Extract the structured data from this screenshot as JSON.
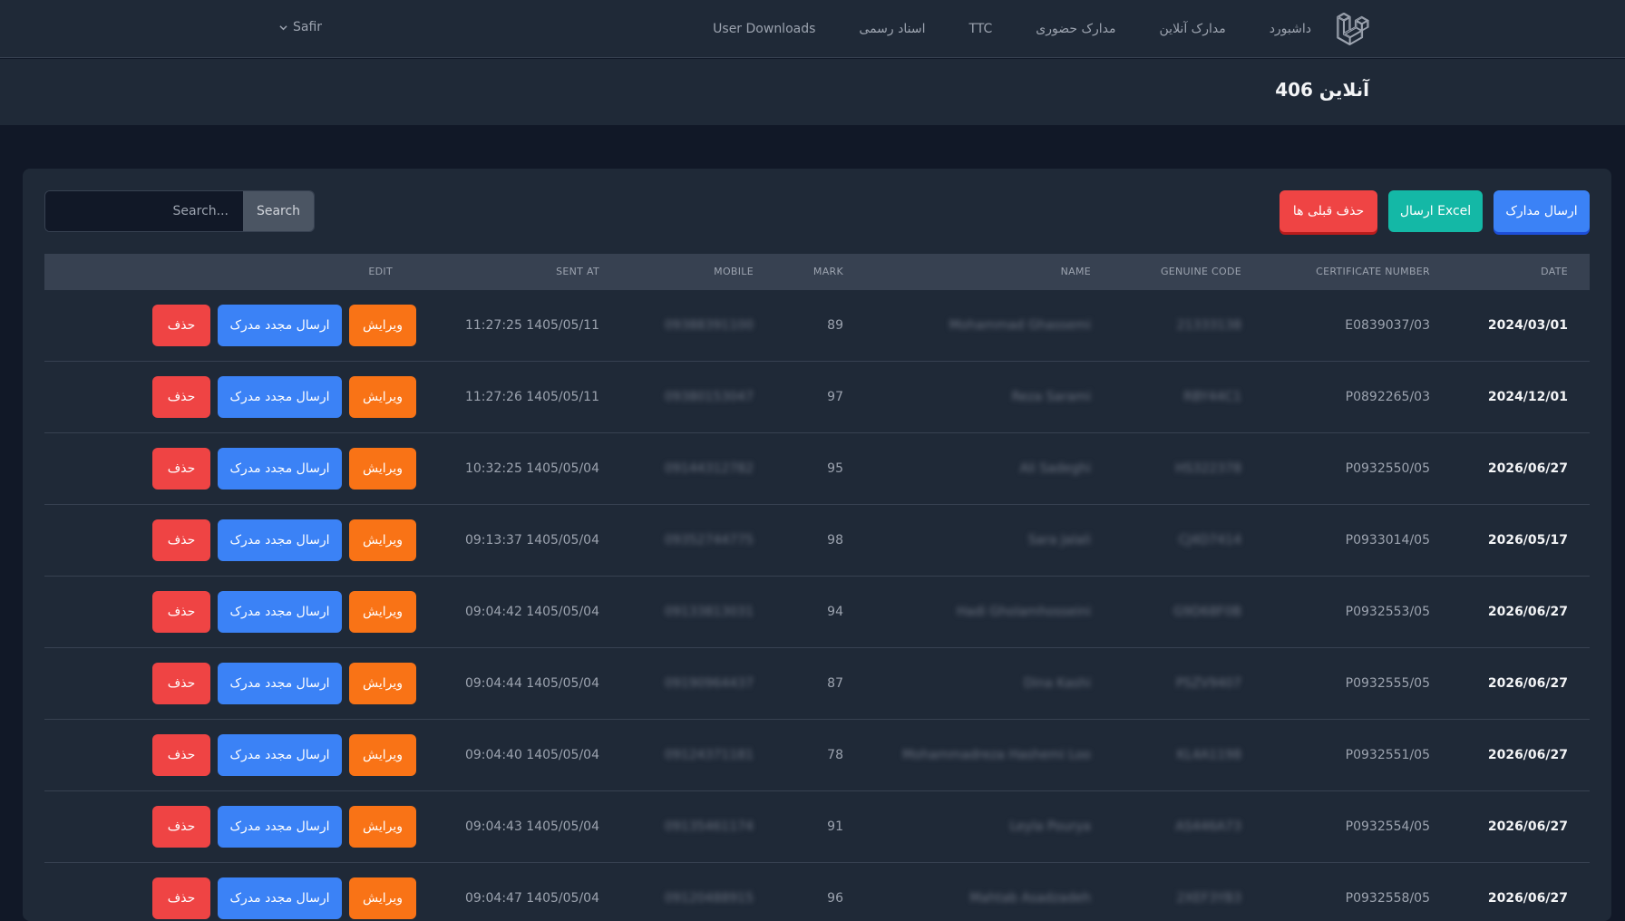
{
  "nav": {
    "links": [
      "داشبورد",
      "مدارک آنلاین",
      "مدارک حضوری",
      "TTC",
      "اسناد رسمی",
      "User Downloads"
    ],
    "user": "Safir"
  },
  "header": {
    "title": "آنلاین 406"
  },
  "toolbar": {
    "send_docs": "ارسال مدارک",
    "send_excel": "ارسال Excel",
    "delete_previous": "حذف قبلی ها",
    "search_placeholder": "Search...",
    "search_button": "Search"
  },
  "table": {
    "headers": {
      "date": "DATE",
      "certificate_number": "CERTIFICATE NUMBER",
      "genuine_code": "GENUINE CODE",
      "name": "NAME",
      "mark": "MARK",
      "mobile": "MOBILE",
      "sent_at": "SENT AT",
      "edit": "EDIT"
    },
    "row_buttons": {
      "edit": "ویرایش",
      "resend": "ارسال مجدد مدرک",
      "delete": "حذف"
    },
    "rows": [
      {
        "date": "2024/03/01",
        "cert": "E0839037/03",
        "code": "21333138",
        "name": "Mohammad Ghassemi",
        "mark": "89",
        "mobile": "09388391100",
        "sent_at": "11:27:25 1405/05/11"
      },
      {
        "date": "2024/12/01",
        "cert": "P0892265/03",
        "code": "RBY44C1",
        "name": "Reza Sarami",
        "mark": "97",
        "mobile": "09380153047",
        "sent_at": "11:27:26 1405/05/11"
      },
      {
        "date": "2026/06/27",
        "cert": "P0932550/05",
        "code": "HS322378",
        "name": "Ali Sadeghi",
        "mark": "95",
        "mobile": "09144312782",
        "sent_at": "10:32:25 1405/05/04"
      },
      {
        "date": "2026/05/17",
        "cert": "P0933014/05",
        "code": "CJ4D7414",
        "name": "Sara Jalali",
        "mark": "98",
        "mobile": "09352744775",
        "sent_at": "09:13:37 1405/05/04"
      },
      {
        "date": "2026/06/27",
        "cert": "P0932553/05",
        "code": "G9D68F0B",
        "name": "Hadi Gholamhosseini",
        "mark": "94",
        "mobile": "09133813031",
        "sent_at": "09:04:42 1405/05/04"
      },
      {
        "date": "2026/06/27",
        "cert": "P0932555/05",
        "code": "PSZV9407",
        "name": "Dina Kashi",
        "mark": "87",
        "mobile": "09190964437",
        "sent_at": "09:04:44 1405/05/04"
      },
      {
        "date": "2026/06/27",
        "cert": "P0932551/05",
        "code": "KL4A1198",
        "name": "Mohammadreza Hashemi Loo",
        "mark": "78",
        "mobile": "09124371181",
        "sent_at": "09:04:40 1405/05/04"
      },
      {
        "date": "2026/06/27",
        "cert": "P0932554/05",
        "code": "AS446A73",
        "name": "Leyla Pourya",
        "mark": "91",
        "mobile": "09135461174",
        "sent_at": "09:04:43 1405/05/04"
      },
      {
        "date": "2026/06/27",
        "cert": "P0932558/05",
        "code": "2XEF3YB3",
        "name": "Mahtab Asadzadeh",
        "mark": "96",
        "mobile": "09120488915",
        "sent_at": "09:04:47 1405/05/04"
      }
    ]
  },
  "colors": {
    "bg": "#111827",
    "panel": "#1f2937",
    "blue": "#3b82f6",
    "teal": "#14b8a6",
    "red": "#ef4444",
    "orange": "#f97316"
  }
}
